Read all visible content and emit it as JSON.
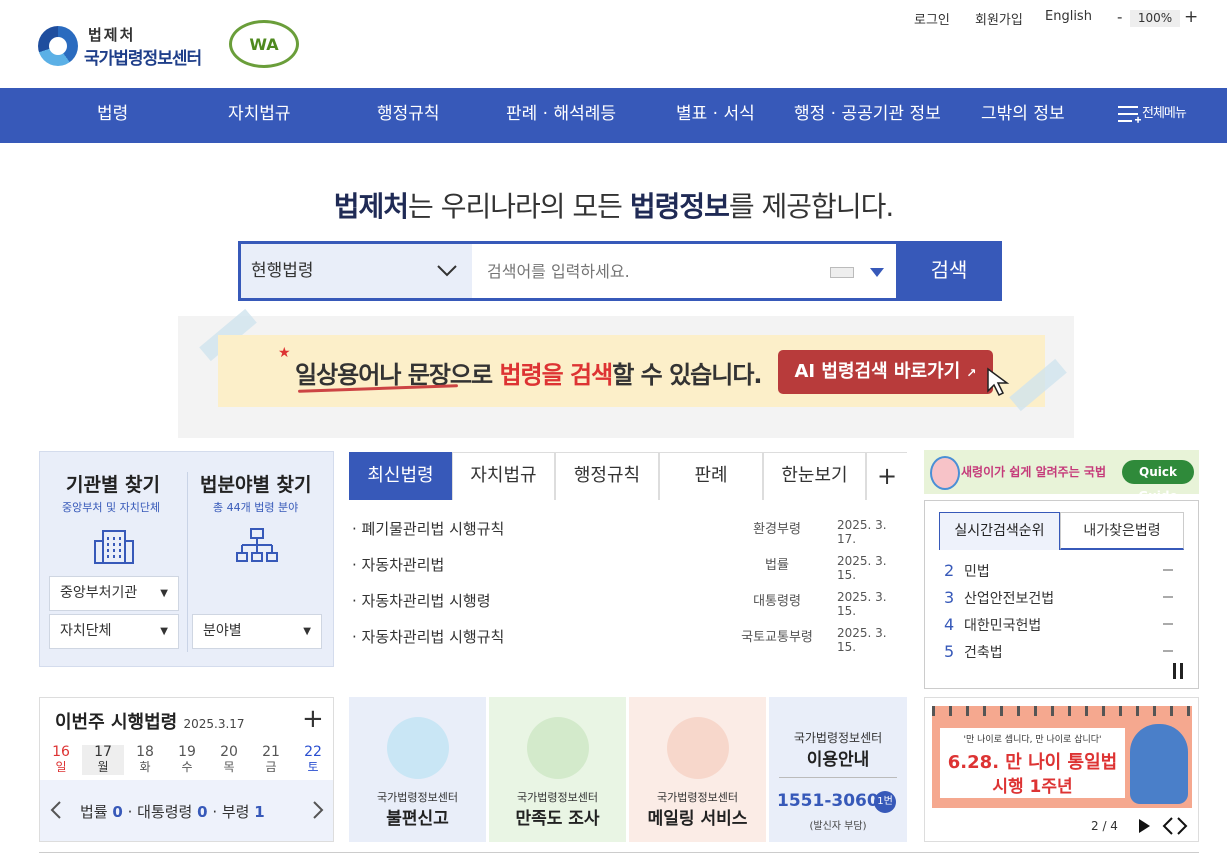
{
  "header": {
    "logo_top": "법제처",
    "logo_main": "국가법령정보센터",
    "wa_mark": "WA",
    "login": "로그인",
    "signup": "회원가입",
    "english": "English",
    "zoom_minus": "-",
    "zoom_level": "100%",
    "zoom_plus": "+"
  },
  "nav": {
    "items": [
      "법령",
      "자치법규",
      "행정규칙",
      "판례 · 해석례등",
      "별표 · 서식",
      "행정 · 공공기관 정보",
      "그밖의 정보"
    ],
    "all_menu": "전체메뉴"
  },
  "hero": {
    "part1": "법제처",
    "part2": "는 우리나라의 모든 ",
    "part3": "법령정보",
    "part4": "를 제공합니다."
  },
  "search": {
    "scope": "현행법령",
    "placeholder": "검색어를 입력하세요.",
    "button": "검색"
  },
  "banner": {
    "text1": "일상용어나 문장으로 ",
    "text2": "법령을 검색",
    "text3": "할 수 있습니다.",
    "button": "AI 법령검색 바로가기"
  },
  "find": {
    "agency_title": "기관별 찾기",
    "agency_sub": "중앙부처 및 자치단체",
    "field_title": "법분야별 찾기",
    "field_sub": "총 44개 법령 분야",
    "dd_central": "중앙부처기관",
    "dd_local": "자치단체",
    "dd_field": "분야별"
  },
  "latest": {
    "tabs": [
      "최신법령",
      "자치법규",
      "행정규칙",
      "판례",
      "한눈보기"
    ],
    "more": "+",
    "rows": [
      {
        "title": "· 폐기물관리법 시행규칙",
        "dept": "환경부령",
        "date": "2025. 3. 17."
      },
      {
        "title": "· 자동차관리법",
        "dept": "법률",
        "date": "2025. 3. 15."
      },
      {
        "title": "· 자동차관리법 시행령",
        "dept": "대통령령",
        "date": "2025. 3. 15."
      },
      {
        "title": "· 자동차관리법 시행규칙",
        "dept": "국토교통부령",
        "date": "2025. 3. 15."
      }
    ]
  },
  "quick_guide": {
    "text": "새령이가 쉽게 알려주는 국법",
    "button": "Quick Guide"
  },
  "ranking": {
    "tab_realtime": "실시간검색순위",
    "tab_mine": "내가찾은법령",
    "items": [
      {
        "n": "2",
        "label": "민법"
      },
      {
        "n": "3",
        "label": "산업안전보건법"
      },
      {
        "n": "4",
        "label": "대한민국헌법"
      },
      {
        "n": "5",
        "label": "건축법"
      }
    ]
  },
  "week": {
    "title": "이번주 시행법령",
    "date": "2025.3.17",
    "more": "+",
    "days": [
      {
        "d": "16",
        "w": "일"
      },
      {
        "d": "17",
        "w": "월"
      },
      {
        "d": "18",
        "w": "화"
      },
      {
        "d": "19",
        "w": "수"
      },
      {
        "d": "20",
        "w": "목"
      },
      {
        "d": "21",
        "w": "금"
      },
      {
        "d": "22",
        "w": "토"
      }
    ],
    "law_label": "법률",
    "law_count": "0",
    "decree_label": "대통령령",
    "decree_count": "0",
    "ministry_label": "부령",
    "ministry_count": "1"
  },
  "services": [
    {
      "top": "국가법령정보센터",
      "name": "불편신고"
    },
    {
      "top": "국가법령정보센터",
      "name": "만족도 조사"
    },
    {
      "top": "국가법령정보센터",
      "name": "메일링 서비스"
    }
  ],
  "guide": {
    "top": "국가법령정보센터",
    "title": "이용안내",
    "phone": "1551-3060",
    "ext": "1번",
    "note": "(발신자 부담)"
  },
  "promo": {
    "line1": "'만 나이로 셉니다, 만 나이로 삽니다'",
    "line2": "6.28. 만 나이 통일법",
    "line3": "시행 1주년",
    "pager": "2 / 4"
  }
}
